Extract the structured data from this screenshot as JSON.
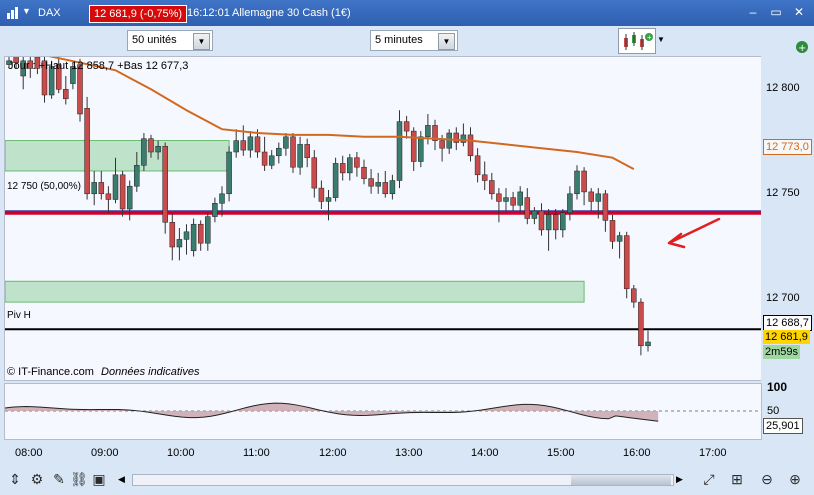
{
  "titlebar": {
    "instrument": "DAX",
    "price_change": "12 681,9 (-0,75%)",
    "time": "16:12:01",
    "title": "Allemagne 30 Cash (1€)",
    "minimize_label": "–",
    "restore_label": "▭",
    "close_label": "✕"
  },
  "toolbar": {
    "units_select": "50 unités",
    "interval_select": "5 minutes",
    "dropdown_arrow": "▼"
  },
  "chart": {
    "info_line": "Jour : +Haut 12 858,7 +Bas 12 677,3",
    "level_label": "12 750 (50,00%)",
    "pivot_label": "Piv H",
    "source_label": "© IT-Finance.com",
    "disclaimer": "Données indicatives",
    "colors": {
      "up": "#3a7d6e",
      "down": "#c94b4b",
      "ma": "#d2691e",
      "resistance_line": "#d1002a",
      "zone": "#8fd19e"
    }
  },
  "price_axis": {
    "ticks": [
      "12 800",
      "12 750",
      "12 700"
    ],
    "ma_tag": "12 773,0",
    "pivot_tag": "12 688,7",
    "price_tag": "12 681,9",
    "countdown": "2m59s"
  },
  "indicator": {
    "ticks": [
      "100",
      "50"
    ],
    "value": "25,901"
  },
  "time_axis": [
    "08:00",
    "09:00",
    "10:00",
    "11:00",
    "12:00",
    "13:00",
    "14:00",
    "15:00",
    "16:00",
    "17:00"
  ],
  "chart_data": {
    "type": "candlestick",
    "ylim": [
      12662,
      12832
    ],
    "series": [
      {
        "t": "08:00",
        "o": 12828,
        "c": 12830,
        "h": 12833,
        "l": 12826
      },
      {
        "t": "08:15",
        "o": 12833,
        "c": 12829,
        "h": 12836,
        "l": 12826
      },
      {
        "t": "08:30",
        "o": 12822,
        "c": 12830,
        "h": 12832,
        "l": 12815
      },
      {
        "t": "08:40",
        "o": 12830,
        "c": 12826,
        "h": 12832,
        "l": 12821
      },
      {
        "t": "08:50",
        "o": 12832,
        "c": 12826,
        "h": 12834,
        "l": 12823
      },
      {
        "t": "09:00",
        "o": 12830,
        "c": 12812,
        "h": 12832,
        "l": 12808
      },
      {
        "t": "09:05",
        "o": 12812,
        "c": 12827,
        "h": 12830,
        "l": 12810
      },
      {
        "t": "09:10",
        "o": 12828,
        "c": 12815,
        "h": 12832,
        "l": 12813
      },
      {
        "t": "09:15",
        "o": 12815,
        "c": 12810,
        "h": 12822,
        "l": 12807
      },
      {
        "t": "09:20",
        "o": 12818,
        "c": 12827,
        "h": 12829,
        "l": 12815
      },
      {
        "t": "09:25",
        "o": 12828,
        "c": 12802,
        "h": 12831,
        "l": 12798
      },
      {
        "t": "09:30",
        "o": 12805,
        "c": 12760,
        "h": 12811,
        "l": 12757
      },
      {
        "t": "09:35",
        "o": 12760,
        "c": 12766,
        "h": 12772,
        "l": 12754
      },
      {
        "t": "09:40",
        "o": 12766,
        "c": 12760,
        "h": 12772,
        "l": 12757
      },
      {
        "t": "09:45",
        "o": 12760,
        "c": 12757,
        "h": 12764,
        "l": 12750
      },
      {
        "t": "09:50",
        "o": 12757,
        "c": 12770,
        "h": 12779,
        "l": 12755
      },
      {
        "t": "09:55",
        "o": 12770,
        "c": 12752,
        "h": 12772,
        "l": 12748
      },
      {
        "t": "10:00",
        "o": 12752,
        "c": 12764,
        "h": 12767,
        "l": 12746
      },
      {
        "t": "10:05",
        "o": 12764,
        "c": 12775,
        "h": 12782,
        "l": 12761
      },
      {
        "t": "10:10",
        "o": 12775,
        "c": 12789,
        "h": 12792,
        "l": 12772
      },
      {
        "t": "10:15",
        "o": 12789,
        "c": 12782,
        "h": 12791,
        "l": 12779
      },
      {
        "t": "10:20",
        "o": 12782,
        "c": 12785,
        "h": 12788,
        "l": 12778
      },
      {
        "t": "10:25",
        "o": 12785,
        "c": 12745,
        "h": 12787,
        "l": 12739
      },
      {
        "t": "10:30",
        "o": 12745,
        "c": 12732,
        "h": 12750,
        "l": 12725
      },
      {
        "t": "10:35",
        "o": 12732,
        "c": 12736,
        "h": 12742,
        "l": 12725
      },
      {
        "t": "10:40",
        "o": 12736,
        "c": 12740,
        "h": 12744,
        "l": 12728
      },
      {
        "t": "10:45",
        "o": 12730,
        "c": 12744,
        "h": 12747,
        "l": 12727
      },
      {
        "t": "10:50",
        "o": 12744,
        "c": 12734,
        "h": 12746,
        "l": 12730
      },
      {
        "t": "10:55",
        "o": 12734,
        "c": 12748,
        "h": 12750,
        "l": 12730
      },
      {
        "t": "11:00",
        "o": 12748,
        "c": 12755,
        "h": 12758,
        "l": 12745
      },
      {
        "t": "11:05",
        "o": 12755,
        "c": 12760,
        "h": 12764,
        "l": 12748
      },
      {
        "t": "11:10",
        "o": 12760,
        "c": 12782,
        "h": 12785,
        "l": 12756
      },
      {
        "t": "11:15",
        "o": 12782,
        "c": 12788,
        "h": 12794,
        "l": 12779
      },
      {
        "t": "11:20",
        "o": 12788,
        "c": 12783,
        "h": 12796,
        "l": 12780
      },
      {
        "t": "11:25",
        "o": 12783,
        "c": 12790,
        "h": 12793,
        "l": 12779
      },
      {
        "t": "11:30",
        "o": 12790,
        "c": 12782,
        "h": 12794,
        "l": 12779
      },
      {
        "t": "11:35",
        "o": 12782,
        "c": 12775,
        "h": 12790,
        "l": 12772
      },
      {
        "t": "11:40",
        "o": 12775,
        "c": 12780,
        "h": 12783,
        "l": 12773
      },
      {
        "t": "11:45",
        "o": 12780,
        "c": 12784,
        "h": 12787,
        "l": 12776
      },
      {
        "t": "11:50",
        "o": 12784,
        "c": 12790,
        "h": 12792,
        "l": 12780
      },
      {
        "t": "11:55",
        "o": 12790,
        "c": 12774,
        "h": 12792,
        "l": 12771
      },
      {
        "t": "12:00",
        "o": 12774,
        "c": 12786,
        "h": 12790,
        "l": 12770
      },
      {
        "t": "12:05",
        "o": 12786,
        "c": 12779,
        "h": 12789,
        "l": 12774
      },
      {
        "t": "12:10",
        "o": 12779,
        "c": 12763,
        "h": 12783,
        "l": 12758
      },
      {
        "t": "12:15",
        "o": 12763,
        "c": 12756,
        "h": 12767,
        "l": 12752
      },
      {
        "t": "12:20",
        "o": 12756,
        "c": 12758,
        "h": 12762,
        "l": 12746
      },
      {
        "t": "12:25",
        "o": 12758,
        "c": 12776,
        "h": 12779,
        "l": 12756
      },
      {
        "t": "12:30",
        "o": 12776,
        "c": 12771,
        "h": 12780,
        "l": 12767
      },
      {
        "t": "12:35",
        "o": 12771,
        "c": 12779,
        "h": 12781,
        "l": 12767
      },
      {
        "t": "12:40",
        "o": 12779,
        "c": 12774,
        "h": 12782,
        "l": 12769
      },
      {
        "t": "12:45",
        "o": 12774,
        "c": 12768,
        "h": 12778,
        "l": 12765
      },
      {
        "t": "12:50",
        "o": 12768,
        "c": 12764,
        "h": 12773,
        "l": 12760
      },
      {
        "t": "12:55",
        "o": 12764,
        "c": 12766,
        "h": 12771,
        "l": 12760
      },
      {
        "t": "13:00",
        "o": 12766,
        "c": 12760,
        "h": 12772,
        "l": 12758
      },
      {
        "t": "13:05",
        "o": 12760,
        "c": 12767,
        "h": 12770,
        "l": 12757
      },
      {
        "t": "13:10",
        "o": 12767,
        "c": 12798,
        "h": 12804,
        "l": 12763
      },
      {
        "t": "13:15",
        "o": 12798,
        "c": 12793,
        "h": 12801,
        "l": 12789
      },
      {
        "t": "13:20",
        "o": 12793,
        "c": 12777,
        "h": 12795,
        "l": 12772
      },
      {
        "t": "13:25",
        "o": 12777,
        "c": 12790,
        "h": 12793,
        "l": 12774
      },
      {
        "t": "13:30",
        "o": 12790,
        "c": 12796,
        "h": 12802,
        "l": 12786
      },
      {
        "t": "13:35",
        "o": 12796,
        "c": 12788,
        "h": 12799,
        "l": 12783
      },
      {
        "t": "13:40",
        "o": 12788,
        "c": 12784,
        "h": 12791,
        "l": 12777
      },
      {
        "t": "13:45",
        "o": 12784,
        "c": 12792,
        "h": 12794,
        "l": 12781
      },
      {
        "t": "13:50",
        "o": 12792,
        "c": 12787,
        "h": 12795,
        "l": 12783
      },
      {
        "t": "13:55",
        "o": 12787,
        "c": 12791,
        "h": 12797,
        "l": 12785
      },
      {
        "t": "14:00",
        "o": 12791,
        "c": 12780,
        "h": 12795,
        "l": 12777
      },
      {
        "t": "14:05",
        "o": 12780,
        "c": 12770,
        "h": 12784,
        "l": 12766
      },
      {
        "t": "14:10",
        "o": 12770,
        "c": 12767,
        "h": 12777,
        "l": 12762
      },
      {
        "t": "14:15",
        "o": 12767,
        "c": 12760,
        "h": 12771,
        "l": 12757
      },
      {
        "t": "14:20",
        "o": 12760,
        "c": 12756,
        "h": 12763,
        "l": 12745
      },
      {
        "t": "14:25",
        "o": 12756,
        "c": 12758,
        "h": 12763,
        "l": 12751
      },
      {
        "t": "14:30",
        "o": 12758,
        "c": 12754,
        "h": 12761,
        "l": 12751
      },
      {
        "t": "14:35",
        "o": 12754,
        "c": 12761,
        "h": 12764,
        "l": 12750
      },
      {
        "t": "14:40",
        "o": 12758,
        "c": 12747,
        "h": 12763,
        "l": 12744
      },
      {
        "t": "14:45",
        "o": 12747,
        "c": 12751,
        "h": 12753,
        "l": 12744
      },
      {
        "t": "14:50",
        "o": 12751,
        "c": 12741,
        "h": 12755,
        "l": 12738
      },
      {
        "t": "14:55",
        "o": 12741,
        "c": 12749,
        "h": 12752,
        "l": 12730
      },
      {
        "t": "15:00",
        "o": 12749,
        "c": 12741,
        "h": 12752,
        "l": 12736
      },
      {
        "t": "15:05",
        "o": 12741,
        "c": 12750,
        "h": 12752,
        "l": 12737
      },
      {
        "t": "15:10",
        "o": 12750,
        "c": 12760,
        "h": 12764,
        "l": 12746
      },
      {
        "t": "15:15",
        "o": 12760,
        "c": 12772,
        "h": 12775,
        "l": 12757
      },
      {
        "t": "15:20",
        "o": 12772,
        "c": 12761,
        "h": 12774,
        "l": 12754
      },
      {
        "t": "15:25",
        "o": 12761,
        "c": 12756,
        "h": 12763,
        "l": 12751
      },
      {
        "t": "15:30",
        "o": 12756,
        "c": 12760,
        "h": 12763,
        "l": 12747
      },
      {
        "t": "15:35",
        "o": 12760,
        "c": 12746,
        "h": 12762,
        "l": 12740
      },
      {
        "t": "15:40",
        "o": 12746,
        "c": 12735,
        "h": 12749,
        "l": 12731
      },
      {
        "t": "15:45",
        "o": 12735,
        "c": 12738,
        "h": 12740,
        "l": 12726
      },
      {
        "t": "15:50",
        "o": 12738,
        "c": 12710,
        "h": 12740,
        "l": 12705
      },
      {
        "t": "15:55",
        "o": 12710,
        "c": 12703,
        "h": 12712,
        "l": 12700
      },
      {
        "t": "16:00",
        "o": 12703,
        "c": 12680,
        "h": 12705,
        "l": 12675
      },
      {
        "t": "16:05",
        "o": 12680,
        "c": 12682,
        "h": 12688,
        "l": 12677
      }
    ],
    "ma": [
      [
        0,
        12834
      ],
      [
        5,
        12833
      ],
      [
        10,
        12829
      ],
      [
        15,
        12825
      ],
      [
        20,
        12815
      ],
      [
        25,
        12804
      ],
      [
        30,
        12794
      ],
      [
        35,
        12792
      ],
      [
        40,
        12791
      ],
      [
        45,
        12791
      ],
      [
        50,
        12790
      ],
      [
        55,
        12790
      ],
      [
        60,
        12789
      ],
      [
        65,
        12788
      ],
      [
        70,
        12786
      ],
      [
        75,
        12784
      ],
      [
        80,
        12782
      ],
      [
        85,
        12779
      ],
      [
        88,
        12773
      ]
    ],
    "levels": {
      "resistance": 12750,
      "pivot": 12688.7
    },
    "zones": [
      {
        "from_idx": 0,
        "to_idx": 31,
        "low": 12772,
        "high": 12788
      },
      {
        "from_idx": 0,
        "to_idx": 81,
        "low": 12703,
        "high": 12714
      }
    ]
  }
}
